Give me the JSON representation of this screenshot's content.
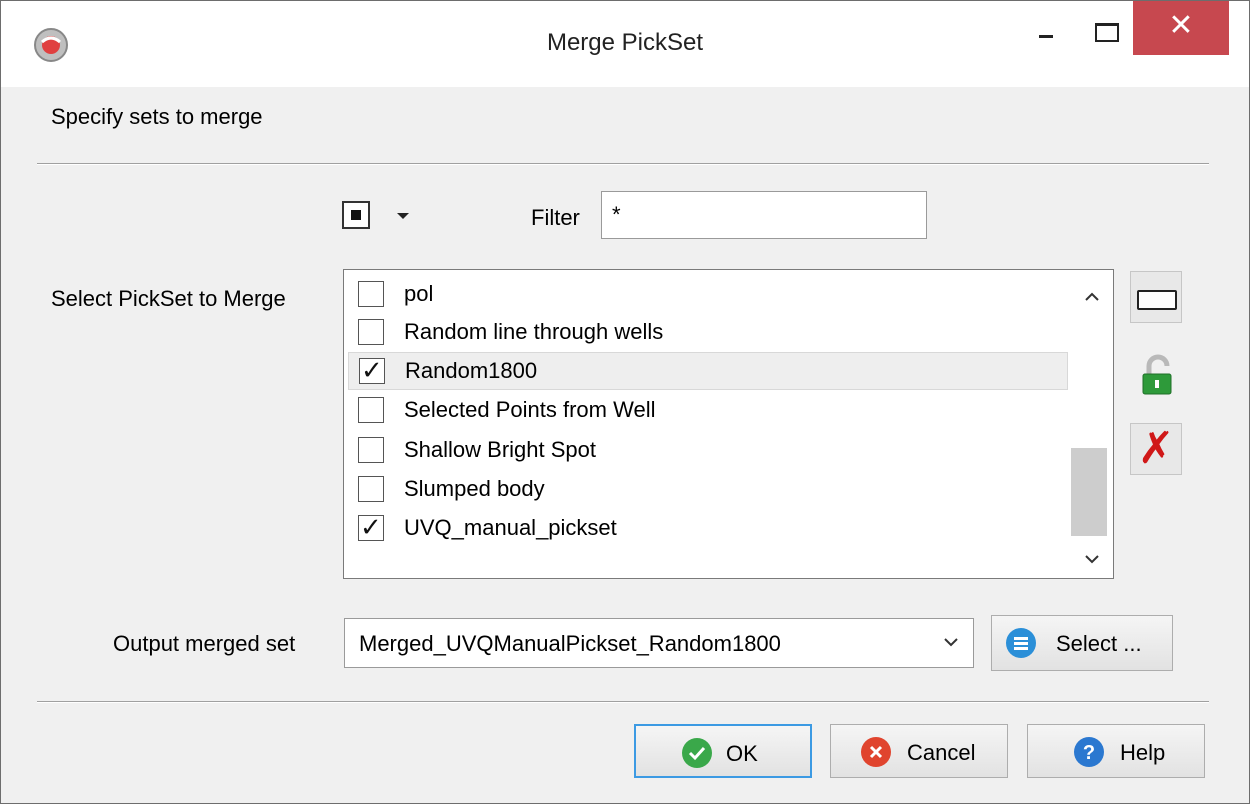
{
  "window": {
    "title": "Merge PickSet",
    "close_label": "✕"
  },
  "header": {
    "label": "Specify sets to merge"
  },
  "filter": {
    "label": "Filter",
    "value": "*"
  },
  "pickset_list": {
    "label": "Select PickSet to Merge",
    "items": [
      {
        "label": "pol",
        "checked": false
      },
      {
        "label": "Random line through wells",
        "checked": false
      },
      {
        "label": "Random1800",
        "checked": true
      },
      {
        "label": "Selected Points from Well",
        "checked": false
      },
      {
        "label": "Shallow Bright Spot",
        "checked": false
      },
      {
        "label": "Slumped body",
        "checked": false
      },
      {
        "label": "UVQ_manual_pickset",
        "checked": true
      }
    ],
    "check_mark": "✓",
    "scroll_up": "^",
    "scroll_down": "v"
  },
  "output": {
    "label": "Output merged set",
    "value": "Merged_UVQManualPickset_Random1800",
    "select_button": "Select ..."
  },
  "buttons": {
    "ok": "OK",
    "cancel": "Cancel",
    "help": "Help"
  },
  "side_buttons": {
    "remove_mark": "✗"
  },
  "colors": {
    "close_button": "#c7484f",
    "ok_focus": "#3c9ae3",
    "ok_icon": "#3aa84a",
    "cancel_icon": "#e0442e",
    "help_icon": "#2b78d0",
    "select_icon": "#2b8fd8",
    "delete_icon": "#d01818"
  }
}
